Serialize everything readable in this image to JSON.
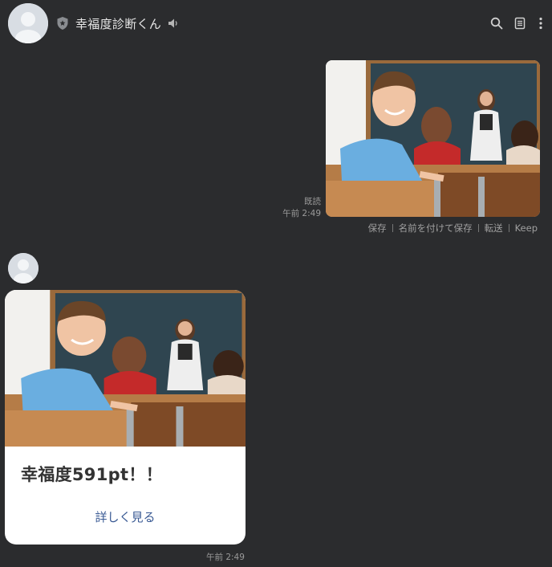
{
  "header": {
    "title": "幸福度診断くん",
    "icons": [
      "shield-icon",
      "speaker-icon",
      "search-icon",
      "notes-icon",
      "more-icon"
    ]
  },
  "sent_message": {
    "read_label": "既読",
    "time": "午前 2:49",
    "actions": [
      "保存",
      "名前を付けて保存",
      "転送",
      "Keep"
    ]
  },
  "received_message": {
    "card_title": "幸福度591pt！！",
    "card_link": "詳しく見る",
    "time": "午前 2:49"
  },
  "colors": {
    "background": "#2b2c2e",
    "card": "#ffffff",
    "link": "#3a5a94",
    "meta_text": "#9a9a9a"
  }
}
